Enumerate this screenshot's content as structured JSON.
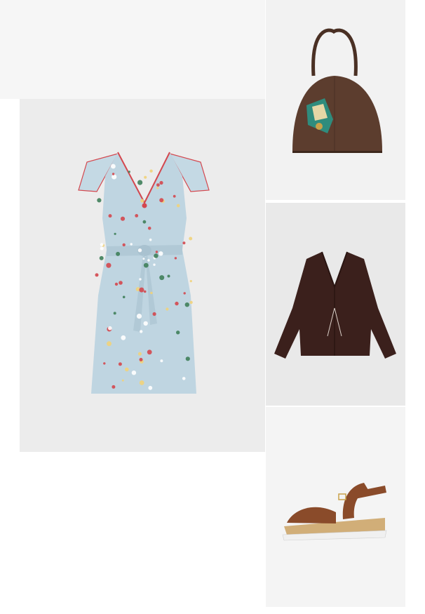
{
  "products": [
    {
      "id": "dress",
      "icon": "floral-mini-dress-image",
      "colors": {
        "base": "#bcd3df",
        "trim": "#d4474e"
      }
    },
    {
      "id": "bag",
      "icon": "brown-leather-handbag-image",
      "colors": {
        "base": "#5a3b2d"
      }
    },
    {
      "id": "jacket",
      "icon": "dark-leather-jacket-image",
      "colors": {
        "base": "#3a1f1c"
      }
    },
    {
      "id": "sandal",
      "icon": "brown-platform-sandal-image",
      "colors": {
        "base": "#8a4b2a",
        "sole": "#d2b07a"
      }
    }
  ]
}
